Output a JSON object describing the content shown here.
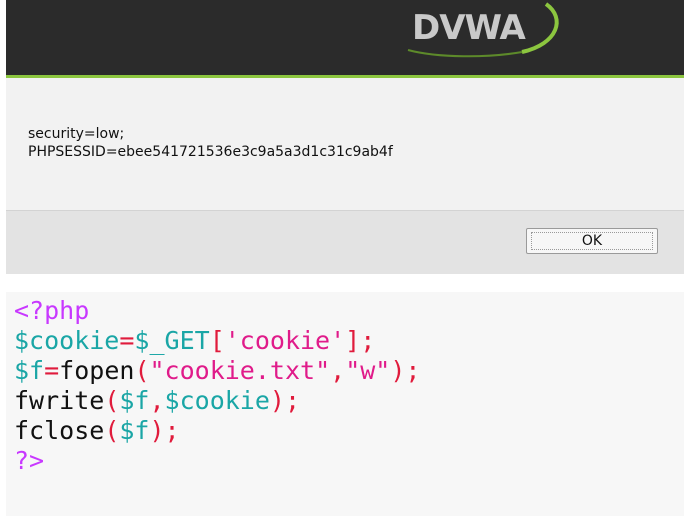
{
  "header": {
    "logo_text": "DVWA"
  },
  "alert": {
    "message_lines": [
      "security=low;",
      "PHPSESSID=ebee541721536e3c9a5a3d1c31c9ab4f"
    ],
    "ok_label": "OK"
  },
  "code": {
    "line1": {
      "open_tag": "<?php"
    },
    "line2": {
      "var": "$cookie",
      "eq": "=",
      "get": "$_GET",
      "lb": "[",
      "key": "'cookie'",
      "rb": "];"
    },
    "line3": {
      "var": "$f",
      "eq": "=",
      "fn": "fopen",
      "lp": "(",
      "arg1": "\"cookie.txt\"",
      "comma": ",",
      "arg2": "\"w\"",
      "rp": ");"
    },
    "line4": {
      "fn": "fwrite",
      "lp": "(",
      "arg1": "$f",
      "comma": ",",
      "arg2": "$cookie",
      "rp": ");"
    },
    "line5": {
      "fn": "fclose",
      "lp": "(",
      "arg1": "$f",
      "rp": ");"
    },
    "line6": {
      "close_tag": "?>"
    }
  },
  "colors": {
    "header_bg": "#2b2b2b",
    "header_accent": "#8cc63f",
    "php_tag": "#c838ff",
    "php_variable": "#1aa6a6",
    "php_operator": "#e01b3c",
    "php_string": "#e01b8a"
  }
}
